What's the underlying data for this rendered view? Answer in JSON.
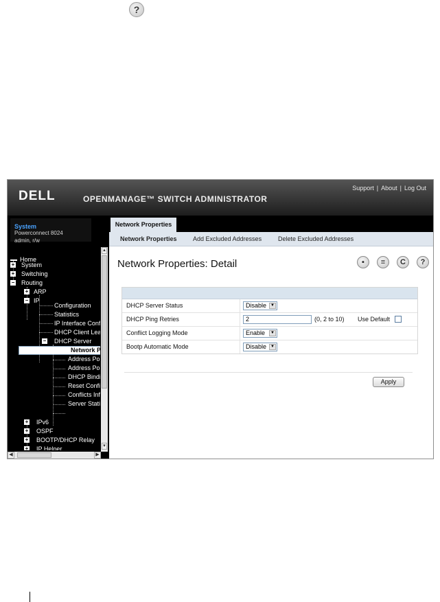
{
  "app": {
    "logo": "DELL",
    "product": "OPENMANAGE™ SWITCH ADMINISTRATOR",
    "links": [
      "Support",
      "About",
      "Log Out"
    ]
  },
  "system": {
    "title": "System",
    "model": "Powerconnect 8024",
    "user": "admin, r/w"
  },
  "tree": [
    {
      "label": "Home"
    },
    {
      "label": "System"
    },
    {
      "label": "Switching"
    },
    {
      "label": "Routing"
    },
    {
      "label": "ARP"
    },
    {
      "label": "IP"
    },
    {
      "label": "Configuration"
    },
    {
      "label": "Statistics"
    },
    {
      "label": "IP Interface Conf"
    },
    {
      "label": "DHCP Client Lea"
    },
    {
      "label": "DHCP Server"
    },
    {
      "label": "Network P"
    },
    {
      "label": "Address Po"
    },
    {
      "label": "Address Po"
    },
    {
      "label": "DHCP Bindi"
    },
    {
      "label": "Reset Confi"
    },
    {
      "label": "Conflicts Inf"
    },
    {
      "label": "Server Statis"
    },
    {
      "label": "IPv6"
    },
    {
      "label": "OSPF"
    },
    {
      "label": "BOOTP/DHCP Relay"
    },
    {
      "label": "IP Helper"
    }
  ],
  "tabs": {
    "active": "Network Properties",
    "sub": [
      "Network Properties",
      "Add Excluded Addresses",
      "Delete Excluded Addresses"
    ]
  },
  "page": {
    "title": "Network Properties: Detail",
    "tool_icons": [
      "save-icon",
      "print-icon",
      "refresh-icon",
      "help-icon"
    ]
  },
  "form": {
    "rows": [
      {
        "label": "DHCP Server Status",
        "value": "Disable"
      },
      {
        "label": "DHCP Ping Retries",
        "value": "2",
        "hint": "(0, 2 to 10)",
        "default_label": "Use Default"
      },
      {
        "label": "Conflict Logging Mode",
        "value": "Enable"
      },
      {
        "label": "Bootp Automatic Mode",
        "value": "Disable"
      }
    ],
    "apply": "Apply"
  }
}
